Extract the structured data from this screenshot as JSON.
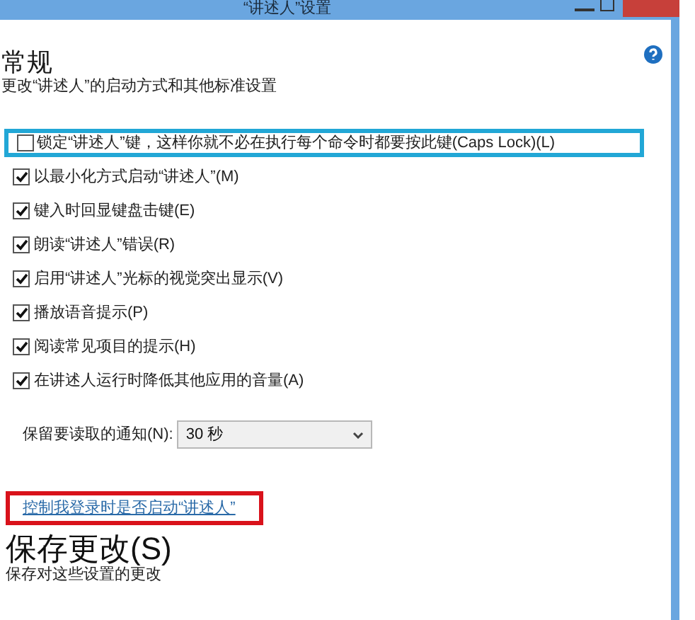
{
  "window": {
    "title": "“讲述人”设置"
  },
  "section": {
    "title": "常规",
    "description": "更改“讲述人”的启动方式和其他标准设置"
  },
  "checkboxes": [
    {
      "label": "锁定“讲述人”键，这样你就不必在执行每个命令时都要按此键(Caps Lock)(L)",
      "checked": false,
      "highlighted": true
    },
    {
      "label": "以最小化方式启动“讲述人”(M)",
      "checked": true,
      "highlighted": false
    },
    {
      "label": "键入时回显键盘击键(E)",
      "checked": true,
      "highlighted": false
    },
    {
      "label": "朗读“讲述人”错误(R)",
      "checked": true,
      "highlighted": false
    },
    {
      "label": "启用“讲述人”光标的视觉突出显示(V)",
      "checked": true,
      "highlighted": false
    },
    {
      "label": "播放语音提示(P)",
      "checked": true,
      "highlighted": false
    },
    {
      "label": "阅读常见项目的提示(H)",
      "checked": true,
      "highlighted": false
    },
    {
      "label": "在讲述人运行时降低其他应用的音量(A)",
      "checked": true,
      "highlighted": false
    }
  ],
  "notification": {
    "label": "保留要读取的通知(N):",
    "value": "30 秒"
  },
  "link": {
    "text": "控制我登录时是否启动“讲述人”",
    "highlighted": true
  },
  "save": {
    "title": "保存更改(S)",
    "description": "保存对这些设置的更改"
  }
}
